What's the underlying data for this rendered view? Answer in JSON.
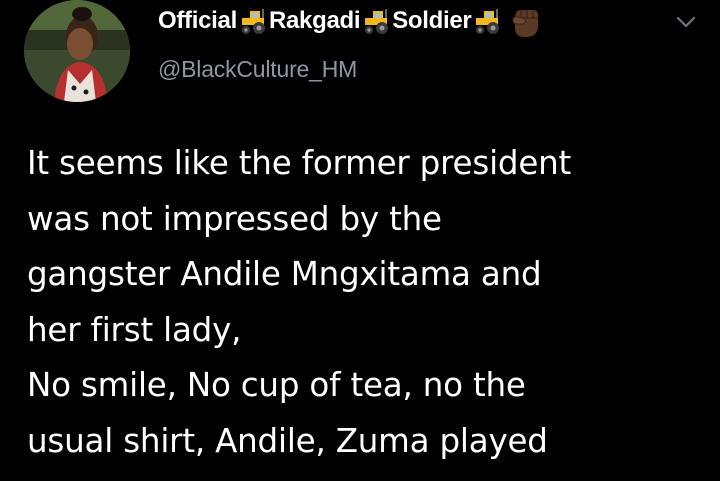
{
  "tweet": {
    "author": {
      "name_parts": [
        "Official",
        "Rakgadi",
        "Soldier"
      ],
      "handle": "@BlackCulture_HM",
      "name_emoji": "tractor-icon",
      "end_emoji": "raised-fist-icon"
    },
    "menu_icon": "chevron-down-icon",
    "text_lines": [
      "It seems like the former president",
      "was not impressed by the",
      "gangster Andile Mngxitama and",
      "her first lady,",
      "No smile, No cup of tea, no the",
      "usual shirt, Andile, Zuma played"
    ]
  },
  "colors": {
    "background": "#000000",
    "text": "#ffffff",
    "secondary_text": "#8b98a5"
  }
}
